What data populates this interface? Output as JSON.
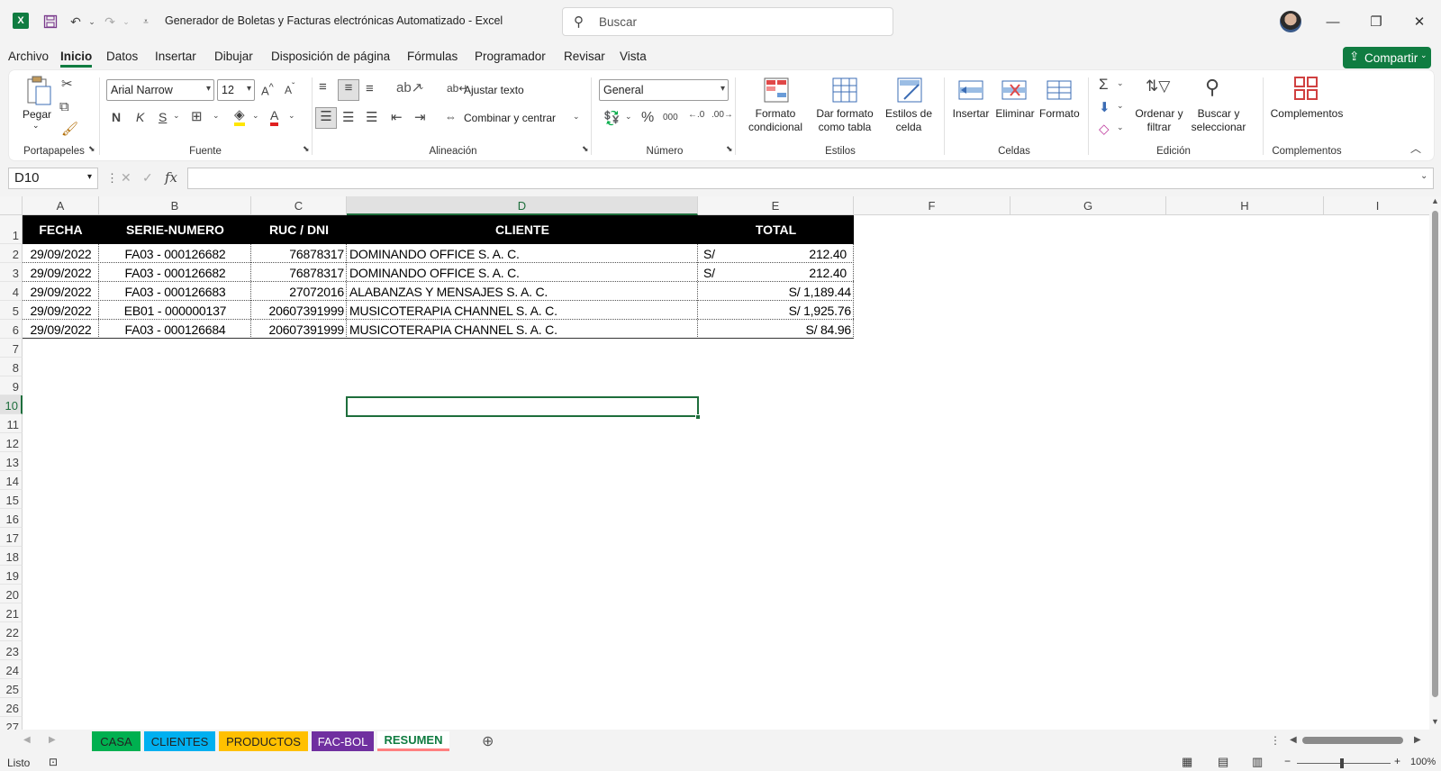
{
  "app": {
    "doc_title": "Generador de Boletas y Facturas electrónicas Automatizado  -  Excel",
    "search_placeholder": "Buscar"
  },
  "menu": [
    "Archivo",
    "Inicio",
    "Datos",
    "Insertar",
    "Dibujar",
    "Disposición de página",
    "Fórmulas",
    "Programador",
    "Revisar",
    "Vista"
  ],
  "share_label": "Compartir",
  "ribbon": {
    "groups": [
      "Portapapeles",
      "Fuente",
      "Alineación",
      "Número",
      "Estilos",
      "Celdas",
      "Edición",
      "Complementos"
    ],
    "paste_label": "Pegar",
    "font_name": "Arial Narrow",
    "font_size": "12",
    "bold": "N",
    "italic": "K",
    "underline": "S",
    "wrap_text": "Ajustar texto",
    "merge_center": "Combinar y centrar",
    "number_format": "General",
    "percent": "%",
    "thousands": "000",
    "cond_format_1": "Formato",
    "cond_format_2": "condicional",
    "table_format_1": "Dar formato",
    "table_format_2": "como tabla",
    "cell_styles_1": "Estilos de",
    "cell_styles_2": "celda",
    "insert": "Insertar",
    "delete": "Eliminar",
    "format": "Formato",
    "sort_1": "Ordenar y",
    "sort_2": "filtrar",
    "find_1": "Buscar y",
    "find_2": "seleccionar",
    "addins": "Complementos"
  },
  "formula_bar": {
    "name_box": "D10",
    "fx": "fx",
    "value": ""
  },
  "columns": [
    "A",
    "B",
    "C",
    "D",
    "E",
    "F",
    "G",
    "H",
    "I"
  ],
  "rows": [
    "1",
    "2",
    "3",
    "4",
    "5",
    "6",
    "7",
    "8",
    "9",
    "10",
    "11",
    "12",
    "13",
    "14",
    "15",
    "16",
    "17",
    "18",
    "19",
    "20",
    "21",
    "22",
    "23",
    "24",
    "25",
    "26",
    "27"
  ],
  "table": {
    "headers": [
      "FECHA",
      "SERIE-NUMERO",
      "RUC / DNI",
      "CLIENTE",
      "TOTAL"
    ],
    "rows": [
      {
        "fecha": "29/09/2022",
        "serie": "FA03 - 000126682",
        "ruc": "76878317",
        "cliente": "DOMINANDO OFFICE S. A. C.",
        "cur": "S/",
        "total": "212.40"
      },
      {
        "fecha": "29/09/2022",
        "serie": "FA03 - 000126682",
        "ruc": "76878317",
        "cliente": "DOMINANDO OFFICE S. A. C.",
        "cur": "S/",
        "total": "212.40"
      },
      {
        "fecha": "29/09/2022",
        "serie": "FA03 - 000126683",
        "ruc": "27072016",
        "cliente": "ALABANZAS Y MENSAJES S. A. C.",
        "cur": "",
        "total": "S/ 1,189.44"
      },
      {
        "fecha": "29/09/2022",
        "serie": "EB01 - 000000137",
        "ruc": "20607391999",
        "cliente": "MUSICOTERAPIA CHANNEL S. A. C.",
        "cur": "",
        "total": "S/ 1,925.76"
      },
      {
        "fecha": "29/09/2022",
        "serie": "FA03 - 000126684",
        "ruc": "20607391999",
        "cliente": "MUSICOTERAPIA CHANNEL S. A. C.",
        "cur": "",
        "total": "S/ 84.96"
      }
    ]
  },
  "sheets": [
    {
      "name": "CASA",
      "color": "#00b050"
    },
    {
      "name": "CLIENTES",
      "color": "#00b0f0"
    },
    {
      "name": "PRODUCTOS",
      "color": "#ffc000"
    },
    {
      "name": "FAC-BOL",
      "color": "#7030a0"
    },
    {
      "name": "RESUMEN",
      "color": "#ff8080",
      "active": true
    }
  ],
  "status": {
    "ready": "Listo",
    "zoom": "100%"
  }
}
